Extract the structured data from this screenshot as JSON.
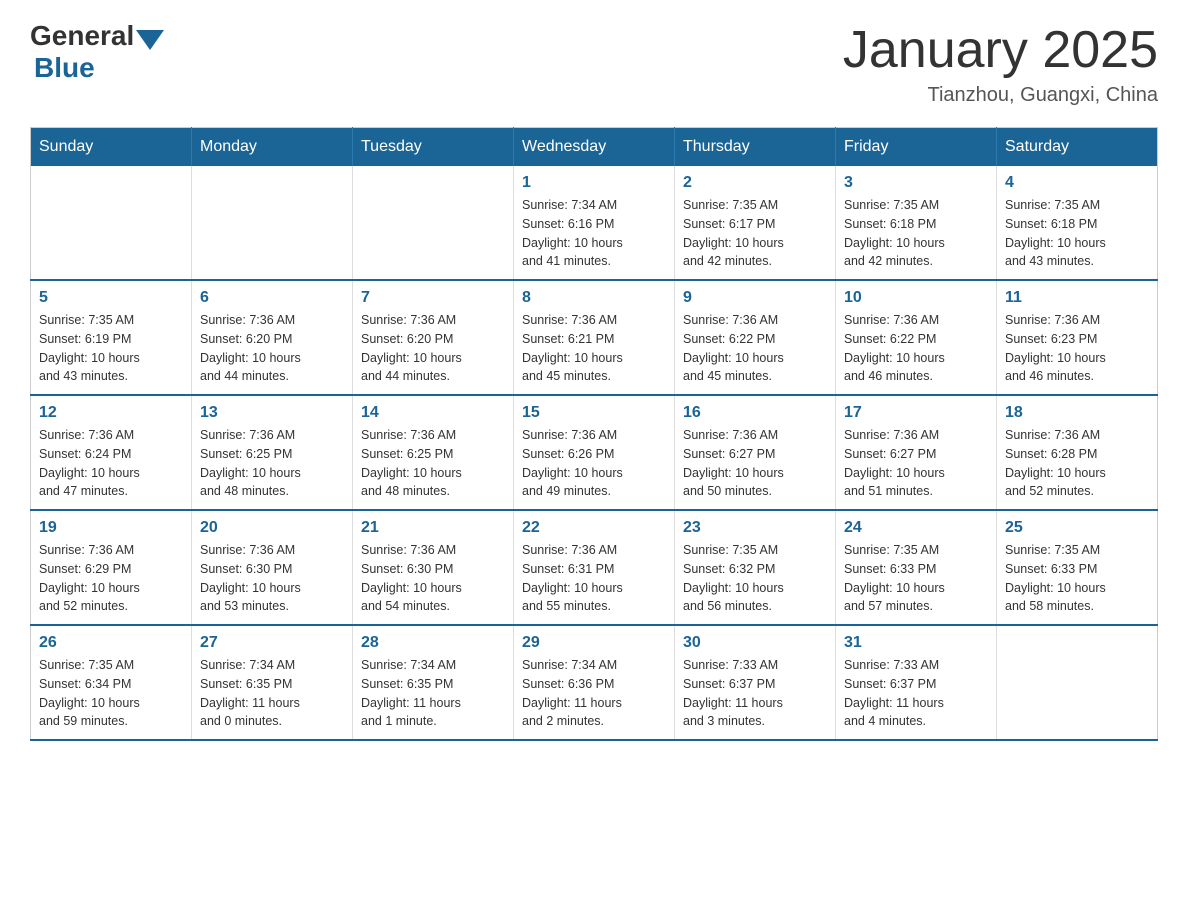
{
  "header": {
    "logo_general": "General",
    "logo_blue": "Blue",
    "title": "January 2025",
    "location": "Tianzhou, Guangxi, China"
  },
  "days_of_week": [
    "Sunday",
    "Monday",
    "Tuesday",
    "Wednesday",
    "Thursday",
    "Friday",
    "Saturday"
  ],
  "weeks": [
    {
      "days": [
        {
          "number": "",
          "info": ""
        },
        {
          "number": "",
          "info": ""
        },
        {
          "number": "",
          "info": ""
        },
        {
          "number": "1",
          "info": "Sunrise: 7:34 AM\nSunset: 6:16 PM\nDaylight: 10 hours\nand 41 minutes."
        },
        {
          "number": "2",
          "info": "Sunrise: 7:35 AM\nSunset: 6:17 PM\nDaylight: 10 hours\nand 42 minutes."
        },
        {
          "number": "3",
          "info": "Sunrise: 7:35 AM\nSunset: 6:18 PM\nDaylight: 10 hours\nand 42 minutes."
        },
        {
          "number": "4",
          "info": "Sunrise: 7:35 AM\nSunset: 6:18 PM\nDaylight: 10 hours\nand 43 minutes."
        }
      ]
    },
    {
      "days": [
        {
          "number": "5",
          "info": "Sunrise: 7:35 AM\nSunset: 6:19 PM\nDaylight: 10 hours\nand 43 minutes."
        },
        {
          "number": "6",
          "info": "Sunrise: 7:36 AM\nSunset: 6:20 PM\nDaylight: 10 hours\nand 44 minutes."
        },
        {
          "number": "7",
          "info": "Sunrise: 7:36 AM\nSunset: 6:20 PM\nDaylight: 10 hours\nand 44 minutes."
        },
        {
          "number": "8",
          "info": "Sunrise: 7:36 AM\nSunset: 6:21 PM\nDaylight: 10 hours\nand 45 minutes."
        },
        {
          "number": "9",
          "info": "Sunrise: 7:36 AM\nSunset: 6:22 PM\nDaylight: 10 hours\nand 45 minutes."
        },
        {
          "number": "10",
          "info": "Sunrise: 7:36 AM\nSunset: 6:22 PM\nDaylight: 10 hours\nand 46 minutes."
        },
        {
          "number": "11",
          "info": "Sunrise: 7:36 AM\nSunset: 6:23 PM\nDaylight: 10 hours\nand 46 minutes."
        }
      ]
    },
    {
      "days": [
        {
          "number": "12",
          "info": "Sunrise: 7:36 AM\nSunset: 6:24 PM\nDaylight: 10 hours\nand 47 minutes."
        },
        {
          "number": "13",
          "info": "Sunrise: 7:36 AM\nSunset: 6:25 PM\nDaylight: 10 hours\nand 48 minutes."
        },
        {
          "number": "14",
          "info": "Sunrise: 7:36 AM\nSunset: 6:25 PM\nDaylight: 10 hours\nand 48 minutes."
        },
        {
          "number": "15",
          "info": "Sunrise: 7:36 AM\nSunset: 6:26 PM\nDaylight: 10 hours\nand 49 minutes."
        },
        {
          "number": "16",
          "info": "Sunrise: 7:36 AM\nSunset: 6:27 PM\nDaylight: 10 hours\nand 50 minutes."
        },
        {
          "number": "17",
          "info": "Sunrise: 7:36 AM\nSunset: 6:27 PM\nDaylight: 10 hours\nand 51 minutes."
        },
        {
          "number": "18",
          "info": "Sunrise: 7:36 AM\nSunset: 6:28 PM\nDaylight: 10 hours\nand 52 minutes."
        }
      ]
    },
    {
      "days": [
        {
          "number": "19",
          "info": "Sunrise: 7:36 AM\nSunset: 6:29 PM\nDaylight: 10 hours\nand 52 minutes."
        },
        {
          "number": "20",
          "info": "Sunrise: 7:36 AM\nSunset: 6:30 PM\nDaylight: 10 hours\nand 53 minutes."
        },
        {
          "number": "21",
          "info": "Sunrise: 7:36 AM\nSunset: 6:30 PM\nDaylight: 10 hours\nand 54 minutes."
        },
        {
          "number": "22",
          "info": "Sunrise: 7:36 AM\nSunset: 6:31 PM\nDaylight: 10 hours\nand 55 minutes."
        },
        {
          "number": "23",
          "info": "Sunrise: 7:35 AM\nSunset: 6:32 PM\nDaylight: 10 hours\nand 56 minutes."
        },
        {
          "number": "24",
          "info": "Sunrise: 7:35 AM\nSunset: 6:33 PM\nDaylight: 10 hours\nand 57 minutes."
        },
        {
          "number": "25",
          "info": "Sunrise: 7:35 AM\nSunset: 6:33 PM\nDaylight: 10 hours\nand 58 minutes."
        }
      ]
    },
    {
      "days": [
        {
          "number": "26",
          "info": "Sunrise: 7:35 AM\nSunset: 6:34 PM\nDaylight: 10 hours\nand 59 minutes."
        },
        {
          "number": "27",
          "info": "Sunrise: 7:34 AM\nSunset: 6:35 PM\nDaylight: 11 hours\nand 0 minutes."
        },
        {
          "number": "28",
          "info": "Sunrise: 7:34 AM\nSunset: 6:35 PM\nDaylight: 11 hours\nand 1 minute."
        },
        {
          "number": "29",
          "info": "Sunrise: 7:34 AM\nSunset: 6:36 PM\nDaylight: 11 hours\nand 2 minutes."
        },
        {
          "number": "30",
          "info": "Sunrise: 7:33 AM\nSunset: 6:37 PM\nDaylight: 11 hours\nand 3 minutes."
        },
        {
          "number": "31",
          "info": "Sunrise: 7:33 AM\nSunset: 6:37 PM\nDaylight: 11 hours\nand 4 minutes."
        },
        {
          "number": "",
          "info": ""
        }
      ]
    }
  ]
}
